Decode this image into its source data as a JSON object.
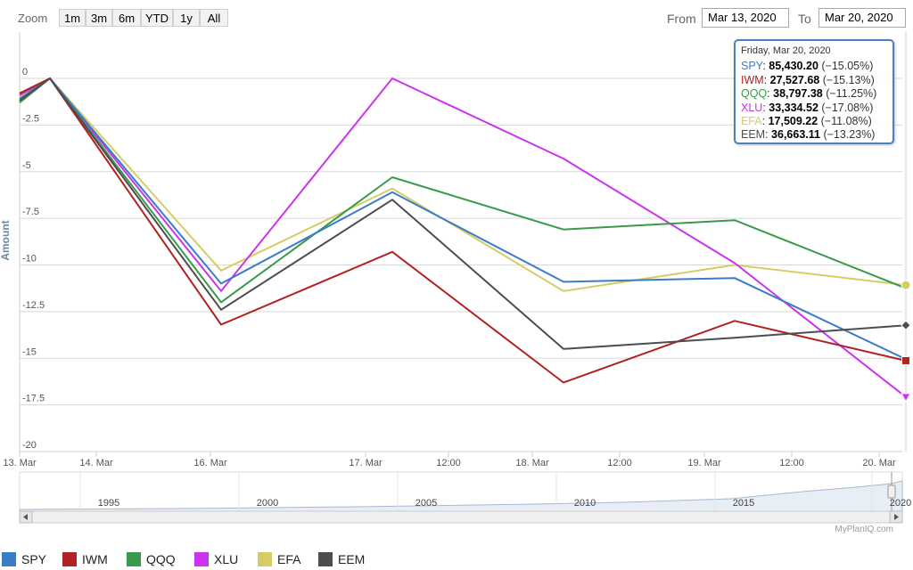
{
  "toolbar": {
    "zoom_label": "Zoom",
    "zoom_buttons": [
      "1m",
      "3m",
      "6m",
      "YTD",
      "1y",
      "All"
    ],
    "from_label": "From",
    "from_value": "Mar 13, 2020",
    "to_label": "To",
    "to_value": "Mar 20, 2020"
  },
  "tooltip": {
    "date": "Friday, Mar 20, 2020",
    "rows": [
      {
        "name": "SPY",
        "value": "85,430.20",
        "change": "(−15.05%)"
      },
      {
        "name": "IWM",
        "value": "27,527.68",
        "change": "(−15.13%)"
      },
      {
        "name": "QQQ",
        "value": "38,797.38",
        "change": "(−11.25%)"
      },
      {
        "name": "XLU",
        "value": "33,334.52",
        "change": "(−17.08%)"
      },
      {
        "name": "EFA",
        "value": "17,509.22",
        "change": "(−11.08%)"
      },
      {
        "name": "EEM",
        "value": "36,663.11",
        "change": "(−13.23%)"
      }
    ]
  },
  "credit": "MyPlanIQ.com",
  "navigator": {
    "years": [
      "1995",
      "2000",
      "2005",
      "2010",
      "2015",
      "2020"
    ]
  },
  "chart_data": {
    "type": "line",
    "ylabel": "Amount",
    "ylim": [
      -20,
      0
    ],
    "yticks": [
      0,
      -2.5,
      -5,
      -7.5,
      -10,
      -12.5,
      -15,
      -17.5,
      -20
    ],
    "ytick_labels": [
      "0",
      "-2.5",
      "-5",
      "-7.5",
      "-10",
      "-12.5",
      "-15",
      "-17.5",
      "-20"
    ],
    "x_tick_labels": [
      "13. Mar",
      "14. Mar",
      "16. Mar",
      "17. Mar",
      "12:00",
      "18. Mar",
      "12:00",
      "19. Mar",
      "12:00",
      "20. Mar"
    ],
    "grid": true,
    "x": [
      "Mar 13, 2020",
      "Mar 16, 2020",
      "Mar 17, 2020",
      "Mar 18, 2020",
      "Mar 19, 2020",
      "Mar 20, 2020"
    ],
    "series": [
      {
        "name": "SPY",
        "color": "#3a7cc7",
        "values": [
          0,
          -11.0,
          -6.1,
          -10.9,
          -10.7,
          -15.05
        ]
      },
      {
        "name": "IWM",
        "color": "#b22222",
        "values": [
          0,
          -13.2,
          -9.3,
          -16.3,
          -13.0,
          -15.13
        ]
      },
      {
        "name": "QQQ",
        "color": "#3a9a4a",
        "values": [
          0,
          -12.0,
          -5.3,
          -8.1,
          -7.6,
          -11.25
        ]
      },
      {
        "name": "XLU",
        "color": "#cc33ee",
        "values": [
          0,
          -11.4,
          0,
          -4.3,
          -9.9,
          -17.08
        ]
      },
      {
        "name": "EFA",
        "color": "#d6cc66",
        "values": [
          0,
          -10.3,
          -5.9,
          -11.4,
          -10.0,
          -11.08
        ]
      },
      {
        "name": "EEM",
        "color": "#4d4d4d",
        "values": [
          0,
          -12.4,
          -6.5,
          -14.5,
          -13.9,
          -13.23
        ]
      }
    ],
    "pre_start_values": [
      {
        "name": "SPY",
        "value": -1.1
      },
      {
        "name": "IWM",
        "value": -0.8
      },
      {
        "name": "QQQ",
        "value": -1.3
      },
      {
        "name": "XLU",
        "value": -0.9
      },
      {
        "name": "EFA",
        "value": -1.0
      },
      {
        "name": "EEM",
        "value": -1.2
      }
    ],
    "end_markers": {
      "SPY": "none",
      "IWM": "square",
      "QQQ": "none",
      "XLU": "triangle-down",
      "EFA": "circle",
      "EEM": "diamond"
    }
  }
}
